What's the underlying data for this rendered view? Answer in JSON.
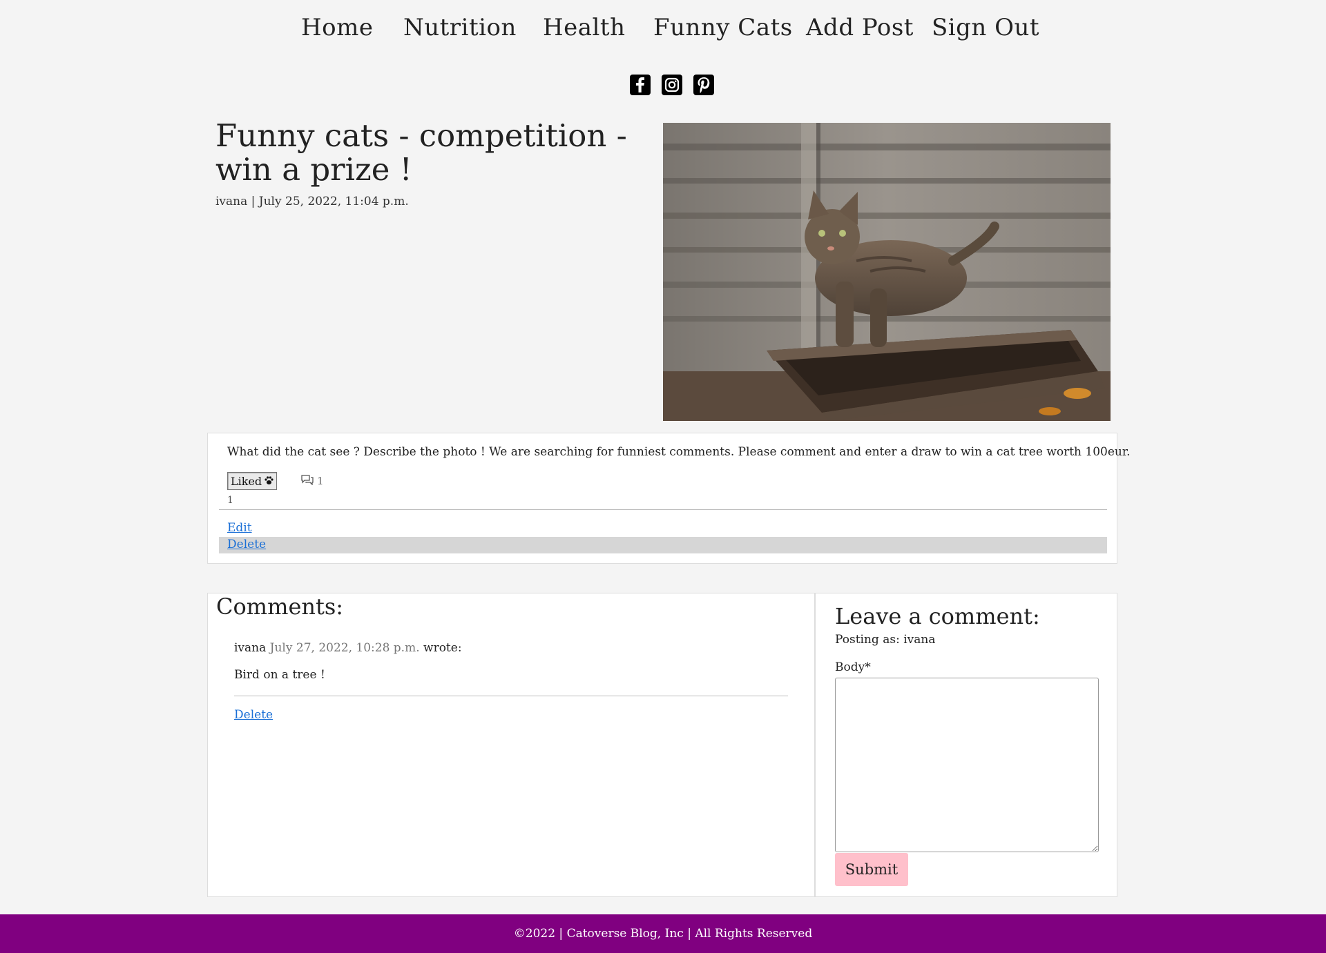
{
  "nav": {
    "items": [
      {
        "label": "Home"
      },
      {
        "label": "Nutrition"
      },
      {
        "label": "Health"
      },
      {
        "label": "Funny Cats"
      },
      {
        "label": "Add Post"
      },
      {
        "label": "Sign Out"
      }
    ]
  },
  "social": {
    "icons": [
      "facebook-icon",
      "instagram-icon",
      "pinterest-icon"
    ]
  },
  "post": {
    "title": "Funny cats - competition - win a prize !",
    "meta": "ivana | July 25, 2022, 11:04 p.m.",
    "body": "What did the cat see ? Describe the photo ! We are searching for funniest comments. Please comment and enter a draw to win a cat tree worth 100eur.",
    "like_label": "Liked",
    "comment_count": "1",
    "like_count": "1",
    "edit_label": "Edit",
    "delete_label": "Delete"
  },
  "comments": {
    "title": "Comments:",
    "items": [
      {
        "author": "ivana",
        "date": "July 27, 2022, 10:28 p.m.",
        "wrote": "wrote:",
        "body": "Bird on a tree !",
        "delete_label": "Delete"
      }
    ]
  },
  "leave_comment": {
    "title": "Leave a comment:",
    "posting_as": "Posting as: ivana",
    "body_label": "Body*",
    "body_value": "",
    "submit_label": "Submit"
  },
  "footer": {
    "text": "©2022 | Catoverse Blog, Inc | All Rights Reserved"
  },
  "colors": {
    "background": "#f4f4f4",
    "footer": "#800080",
    "link": "#1a6fd6",
    "submit": "#ffc0cb"
  }
}
